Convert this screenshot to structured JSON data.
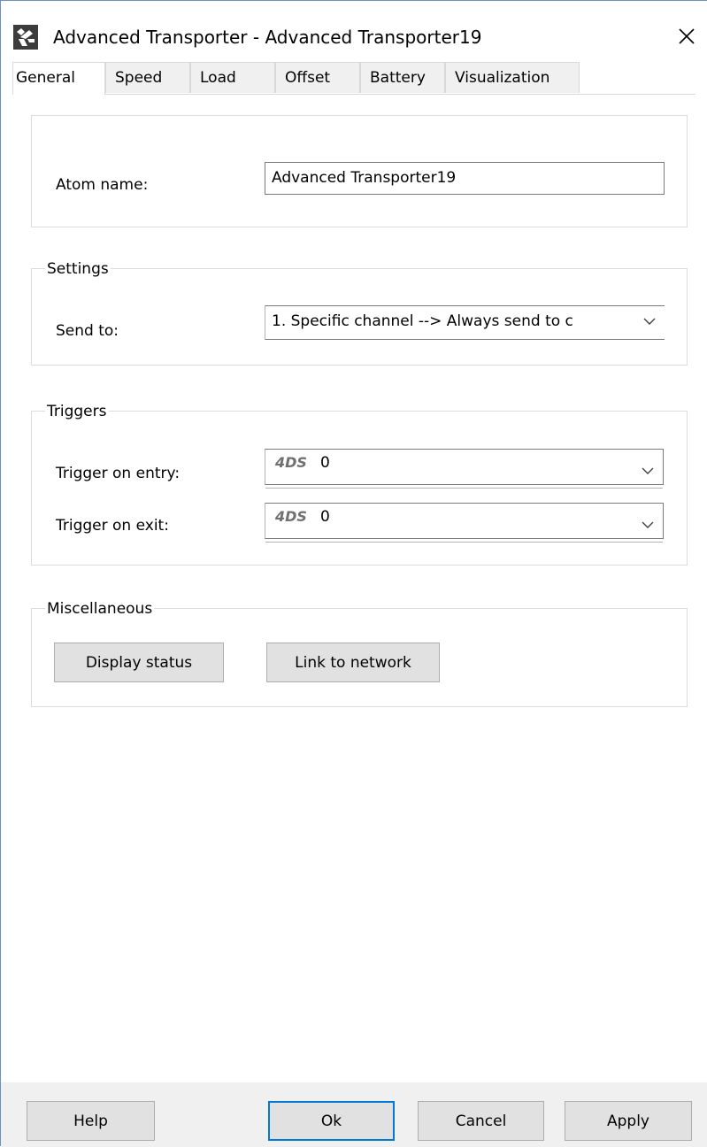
{
  "window": {
    "title": "Advanced Transporter - Advanced Transporter19",
    "icon": "transporter-app-icon",
    "close_icon": "close-icon"
  },
  "tabs": [
    {
      "label": "General",
      "active": true
    },
    {
      "label": "Speed",
      "active": false
    },
    {
      "label": "Load",
      "active": false
    },
    {
      "label": "Offset",
      "active": false
    },
    {
      "label": "Battery",
      "active": false
    },
    {
      "label": "Visualization",
      "active": false
    }
  ],
  "atom": {
    "label": "Atom name:",
    "value": "Advanced Transporter19"
  },
  "settings": {
    "title": "Settings",
    "send_to_label": "Send to:",
    "send_to_value": "1. Specific channel --> Always send to c"
  },
  "triggers": {
    "title": "Triggers",
    "entry_label": "Trigger on entry:",
    "entry_prefix": "4DS",
    "entry_value": "0",
    "exit_label": "Trigger on exit:",
    "exit_prefix": "4DS",
    "exit_value": "0"
  },
  "misc": {
    "title": "Miscellaneous",
    "display_status_label": "Display status",
    "link_network_label": "Link to network"
  },
  "footer": {
    "help": "Help",
    "ok": "Ok",
    "cancel": "Cancel",
    "apply": "Apply"
  }
}
